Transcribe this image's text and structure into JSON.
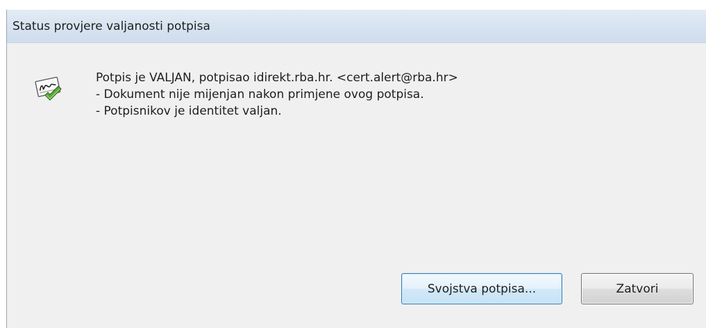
{
  "dialog": {
    "title": "Status provjere valjanosti potpisa",
    "icon": "signature-valid-icon",
    "message_lines": [
      "Potpis je VALJAN, potpisao idirekt.rba.hr. <cert.alert@rba.hr>",
      "- Dokument nije mijenjan nakon primjene ovog potpisa.",
      "- Potpisnikov je identitet valjan."
    ],
    "buttons": {
      "properties_label": "Svojstva potpisa...",
      "close_label": "Zatvori"
    }
  },
  "colors": {
    "titlebar": "#d8e4f1",
    "window_bg": "#f0f0f0",
    "default_button_border": "#3c7fb1",
    "checkmark_green": "#5aa83a"
  }
}
